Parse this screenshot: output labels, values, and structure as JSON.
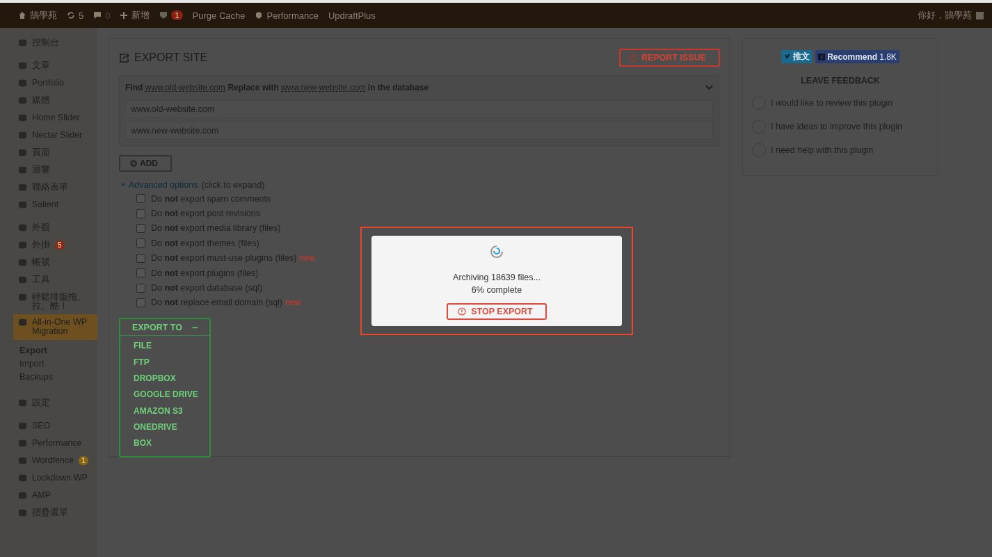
{
  "admin_bar": {
    "items": [
      {
        "kind": "site",
        "label": "鵠學苑"
      },
      {
        "kind": "updates",
        "label": "5"
      },
      {
        "kind": "comments",
        "label": "0"
      },
      {
        "kind": "new",
        "label": "新增"
      },
      {
        "kind": "seo",
        "badge": "1"
      },
      {
        "kind": "link",
        "label": "Purge Cache"
      },
      {
        "kind": "performance",
        "label": "Performance"
      },
      {
        "kind": "link",
        "label": "UpdraftPlus"
      }
    ],
    "greeting": "你好，鵠學苑"
  },
  "sidebar": {
    "groups": [
      {
        "items": [
          {
            "label": "控制台",
            "selected": false
          }
        ]
      },
      {
        "items": [
          {
            "label": "文章",
            "selected": false
          },
          {
            "label": "Portfolio",
            "selected": false
          },
          {
            "label": "媒體",
            "selected": false
          },
          {
            "label": "Home Slider",
            "selected": false
          },
          {
            "label": "Nectar Slider",
            "selected": false
          },
          {
            "label": "頁面",
            "selected": false
          },
          {
            "label": "迴響",
            "selected": false
          },
          {
            "label": "聯絡表單",
            "selected": false
          },
          {
            "label": "Salient",
            "selected": false
          }
        ]
      },
      {
        "items": [
          {
            "label": "外觀",
            "selected": false
          },
          {
            "label": "外掛",
            "selected": false,
            "badge": {
              "text": "5",
              "color": "#8a2a12"
            }
          },
          {
            "label": "帳號",
            "selected": false
          },
          {
            "label": "工具",
            "selected": false
          },
          {
            "label": "輕鬆排版拖、拉、酷！",
            "selected": false
          },
          {
            "label": "All-in-One WP Migration",
            "selected": true,
            "children": [
              {
                "label": "Export",
                "selected": true
              },
              {
                "label": "Import",
                "selected": false
              },
              {
                "label": "Backups",
                "selected": false
              }
            ]
          }
        ]
      },
      {
        "items": [
          {
            "label": "設定",
            "selected": false
          }
        ]
      },
      {
        "items": [
          {
            "label": "SEO",
            "selected": false
          },
          {
            "label": "Performance",
            "selected": false
          },
          {
            "label": "Wordfence",
            "selected": false,
            "badge": {
              "text": "1",
              "color": "#8a6a10"
            }
          },
          {
            "label": "Lockdown WP",
            "selected": false
          },
          {
            "label": "AMP",
            "selected": false
          },
          {
            "label": "摺疊選單",
            "selected": false
          }
        ]
      }
    ]
  },
  "export_panel": {
    "title": "EXPORT SITE",
    "report_button": "REPORT ISSUE",
    "find_replace": {
      "heading_parts": [
        "Find",
        "www.old-website.com",
        "Replace with",
        "www.new-website.com",
        "in the database"
      ],
      "find_value": "www.old-website.com",
      "replace_value": "www.new-website.com"
    },
    "add_button": "ADD",
    "advanced": {
      "link": "Advanced options",
      "hint": "(click to expand)",
      "expanded": true
    },
    "options": [
      {
        "text": "Do **not** export spam comments",
        "checked": false
      },
      {
        "text": "Do **not** export post revisions",
        "checked": false
      },
      {
        "text": "Do **not** export media library (files)",
        "checked": false
      },
      {
        "text": "Do **not** export themes (files)",
        "checked": false
      },
      {
        "text": "Do **not** export must-use plugins (files)",
        "checked": false,
        "tag": "new"
      },
      {
        "text": "Do **not** export plugins (files)",
        "checked": false
      },
      {
        "text": "Do **not** export database (sql)",
        "checked": false
      },
      {
        "text": "Do **not** replace email domain (sql)",
        "checked": false,
        "tag": "new"
      }
    ],
    "export_to": {
      "label": "EXPORT TO",
      "toggle": "−",
      "targets": [
        "FILE",
        "FTP",
        "DROPBOX",
        "GOOGLE DRIVE",
        "AMAZON S3",
        "ONEDRIVE",
        "BOX"
      ]
    }
  },
  "feedback_panel": {
    "tweet_button": "推文",
    "recommend_button": "Recommend",
    "recommend_count": "1.8K",
    "title": "LEAVE FEEDBACK",
    "choices": [
      {
        "label": "I would like to review this plugin",
        "selected": false
      },
      {
        "label": "I have ideas to improve this plugin",
        "selected": false
      },
      {
        "label": "I need help with this plugin",
        "selected": false
      }
    ]
  },
  "progress_modal": {
    "message": "Archiving 18639 files...",
    "progress": "6% complete",
    "stop_button": "STOP EXPORT"
  }
}
